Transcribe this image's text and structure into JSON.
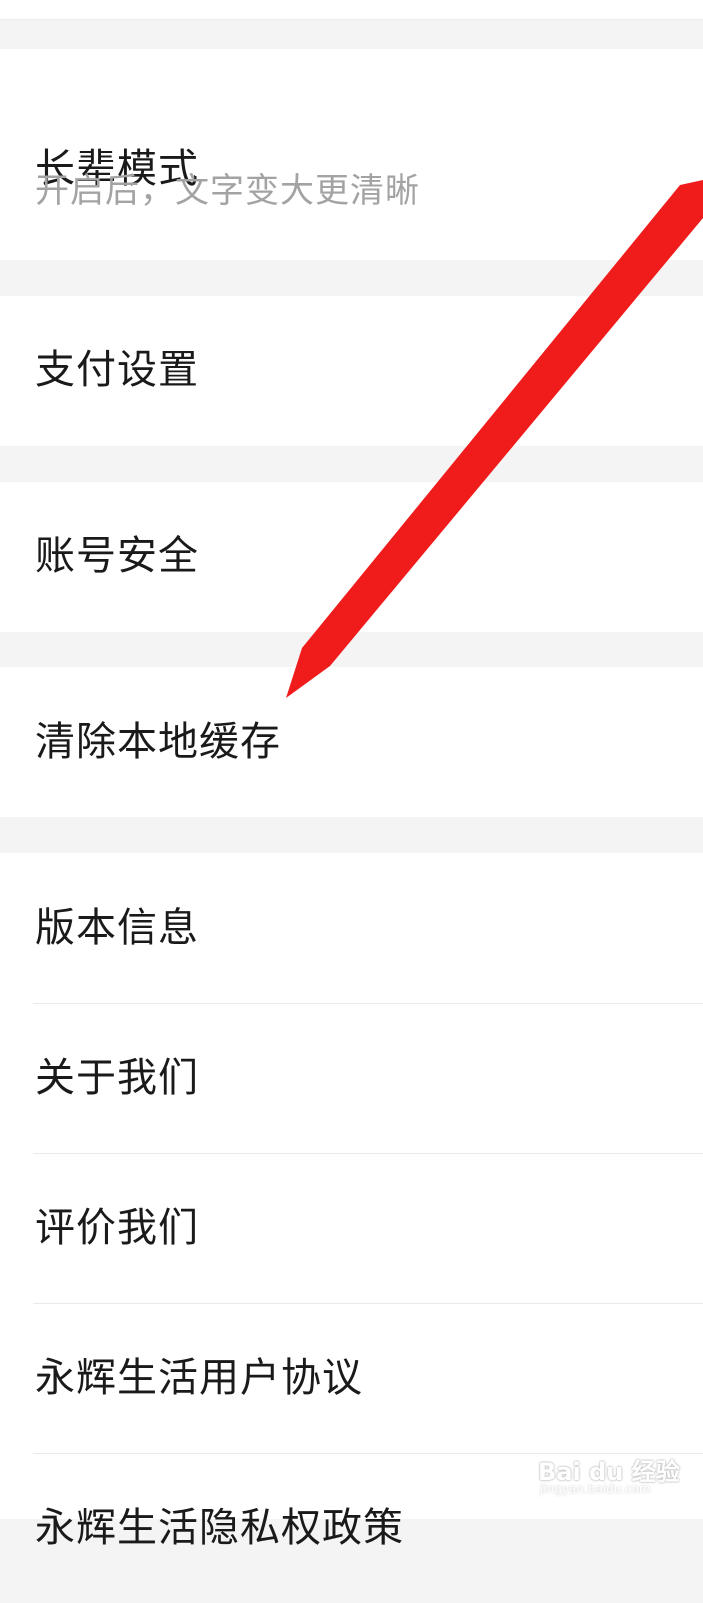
{
  "settings": {
    "elder_mode": {
      "label": "长辈模式",
      "description": "开启后，文字变大更清晰"
    },
    "payment_settings": {
      "label": "支付设置"
    },
    "account_security": {
      "label": "账号安全"
    },
    "clear_cache": {
      "label": "清除本地缓存"
    },
    "version_info": {
      "label": "版本信息"
    },
    "about_us": {
      "label": "关于我们"
    },
    "rate_us": {
      "label": "评价我们"
    },
    "user_agreement": {
      "label": "永辉生活用户协议"
    },
    "privacy_policy": {
      "label": "永辉生活隐私权政策"
    }
  },
  "annotation": {
    "arrow_color": "#f01c1c",
    "points_to": "clear_cache"
  },
  "watermark": {
    "main": "Bai du 经验",
    "sub": "jingyan.baidu.com"
  },
  "colors": {
    "background": "#f4f4f4",
    "card": "#ffffff",
    "text": "#1a1a1a",
    "subtext": "#a3a3a3"
  }
}
